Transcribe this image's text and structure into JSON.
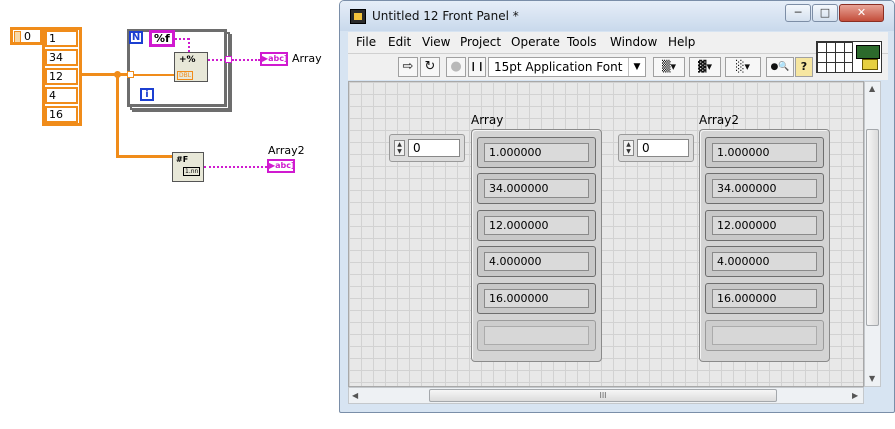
{
  "diagram": {
    "index_const": "0",
    "array_values": [
      "1",
      "34",
      "12",
      "4",
      "16"
    ],
    "format_string": "%f",
    "loop_count": "N",
    "loop_iter": "i",
    "dbl_label": "DBL",
    "indicator1": "Array",
    "indicator2": "Array2",
    "abc_glyph": "▶abc]"
  },
  "window": {
    "title": "Untitled 12 Front Panel *",
    "minimize": "─",
    "maximize": "□",
    "close": "✕",
    "menu": [
      "File",
      "Edit",
      "View",
      "Project",
      "Operate",
      "Tools",
      "Window",
      "Help"
    ],
    "toolbar": {
      "run": "⇨",
      "run_cont": "↻",
      "abort": "●",
      "pause": "❙❙",
      "font": "15pt Application Font",
      "font_dd": "▼",
      "align": "▒▾",
      "distribute": "▓▾",
      "resize": "░▾",
      "search": "●🔍",
      "help": "?"
    },
    "hscroll_grip": "III"
  },
  "panel": {
    "array1": {
      "label": "Array",
      "index": "0",
      "elements": [
        "1.000000",
        "34.000000",
        "12.000000",
        "4.000000",
        "16.000000",
        ""
      ]
    },
    "array2": {
      "label": "Array2",
      "index": "0",
      "elements": [
        "1.000000",
        "34.000000",
        "12.000000",
        "4.000000",
        "16.000000",
        ""
      ]
    }
  },
  "colors": {
    "numeric_wire": "#f08c1a",
    "string_wire": "#d01ad0",
    "loop_blue": "#1c3fd1"
  }
}
